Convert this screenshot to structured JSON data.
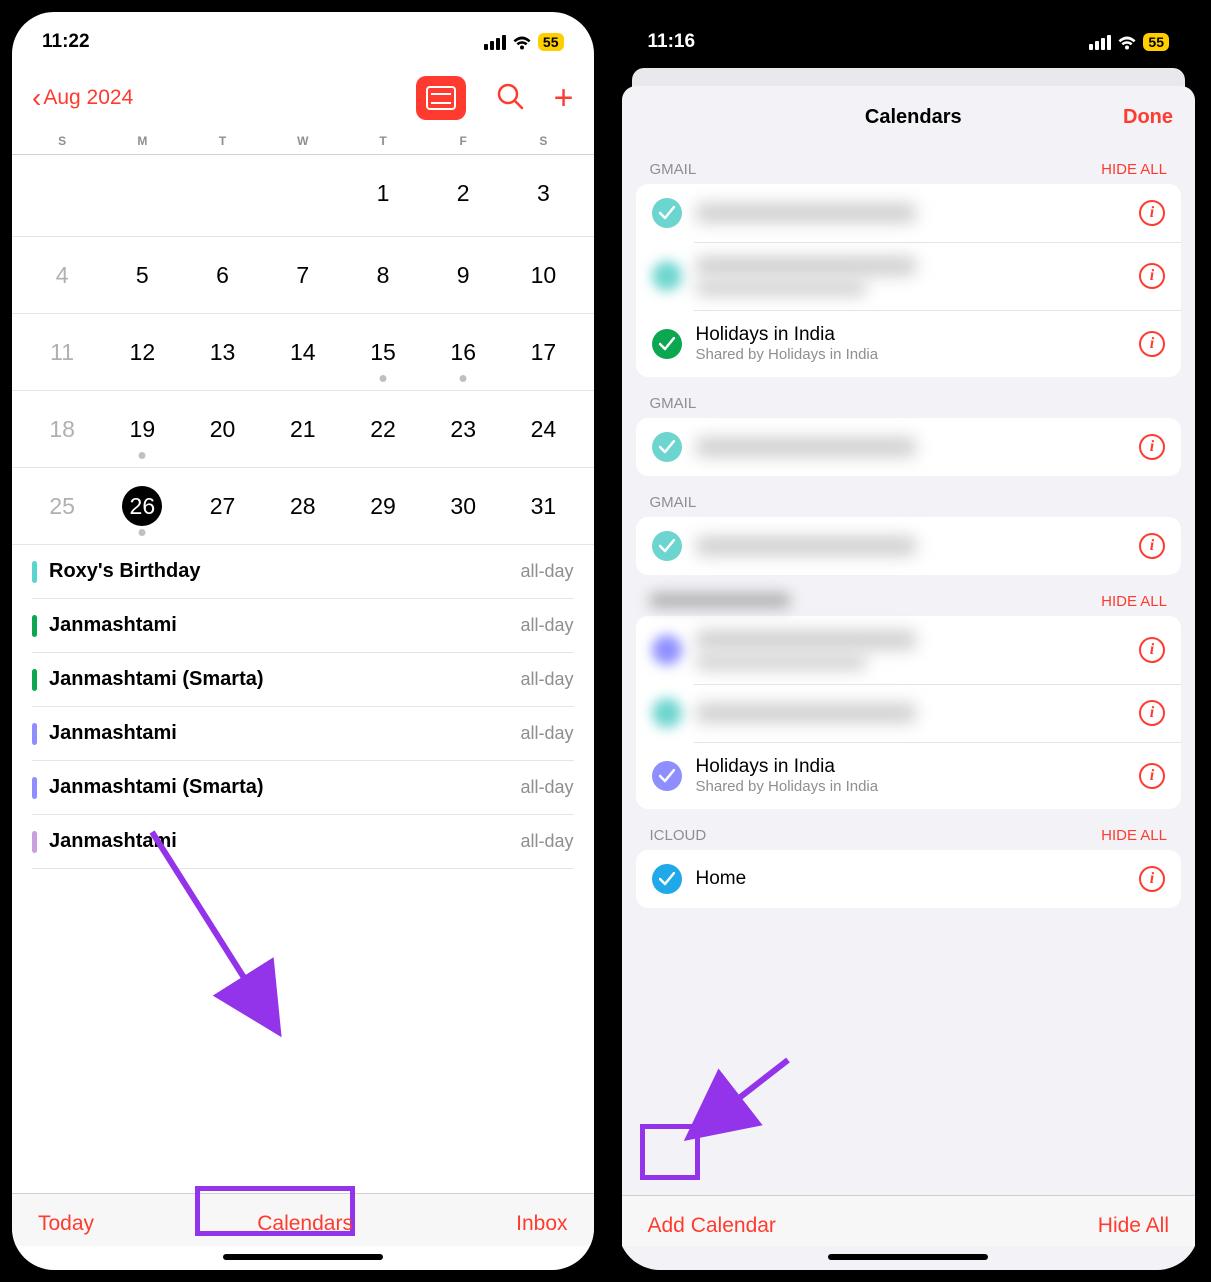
{
  "left": {
    "status": {
      "time": "11:22",
      "battery": "55"
    },
    "header": {
      "back": "Aug 2024"
    },
    "weekdays": [
      "S",
      "M",
      "T",
      "W",
      "T",
      "F",
      "S"
    ],
    "weeks": [
      [
        {
          "n": "",
          "d": false
        },
        {
          "n": "",
          "d": false
        },
        {
          "n": "",
          "d": false
        },
        {
          "n": "",
          "d": false
        },
        {
          "n": "1",
          "d": false
        },
        {
          "n": "2",
          "d": false
        },
        {
          "n": "3",
          "d": false
        }
      ],
      [
        {
          "n": "4",
          "d": true
        },
        {
          "n": "5",
          "d": false
        },
        {
          "n": "6",
          "d": false
        },
        {
          "n": "7",
          "d": false
        },
        {
          "n": "8",
          "d": false
        },
        {
          "n": "9",
          "d": false
        },
        {
          "n": "10",
          "d": false
        }
      ],
      [
        {
          "n": "11",
          "d": true
        },
        {
          "n": "12",
          "d": false
        },
        {
          "n": "13",
          "d": false
        },
        {
          "n": "14",
          "d": false
        },
        {
          "n": "15",
          "d": false,
          "dot": true
        },
        {
          "n": "16",
          "d": false,
          "dot": true
        },
        {
          "n": "17",
          "d": false
        }
      ],
      [
        {
          "n": "18",
          "d": true
        },
        {
          "n": "19",
          "d": false,
          "dot": true
        },
        {
          "n": "20",
          "d": false
        },
        {
          "n": "21",
          "d": false
        },
        {
          "n": "22",
          "d": false
        },
        {
          "n": "23",
          "d": false
        },
        {
          "n": "24",
          "d": false
        }
      ],
      [
        {
          "n": "25",
          "d": true
        },
        {
          "n": "26",
          "d": false,
          "today": true,
          "dot": true
        },
        {
          "n": "27",
          "d": false
        },
        {
          "n": "28",
          "d": false
        },
        {
          "n": "29",
          "d": false
        },
        {
          "n": "30",
          "d": false
        },
        {
          "n": "31",
          "d": false
        }
      ]
    ],
    "events": [
      {
        "title": "Roxy's Birthday",
        "time": "all-day",
        "color": "#5ad4cf"
      },
      {
        "title": "Janmashtami",
        "time": "all-day",
        "color": "#0ca750"
      },
      {
        "title": "Janmashtami (Smarta)",
        "time": "all-day",
        "color": "#0ca750"
      },
      {
        "title": "Janmashtami",
        "time": "all-day",
        "color": "#8e8eff"
      },
      {
        "title": "Janmashtami (Smarta)",
        "time": "all-day",
        "color": "#8e8eff"
      },
      {
        "title": "Janmashtami",
        "time": "all-day",
        "color": "#c99fdf"
      }
    ],
    "toolbar": {
      "today": "Today",
      "calendars": "Calendars",
      "inbox": "Inbox"
    }
  },
  "right": {
    "status": {
      "time": "11:16",
      "battery": "55"
    },
    "sheet": {
      "title": "Calendars",
      "done": "Done"
    },
    "sections": [
      {
        "header": "GMAIL",
        "hideAll": "HIDE ALL",
        "items": [
          {
            "check": "#6dd5cf",
            "blurred": true
          },
          {
            "check": "#6dd5cf",
            "checkBlur": true,
            "blurred": true,
            "sub": true
          },
          {
            "check": "#0ca750",
            "name": "Holidays in India",
            "subText": "Shared by Holidays in India"
          }
        ]
      },
      {
        "header": "GMAIL",
        "items": [
          {
            "check": "#6dd5cf",
            "blurred": true
          }
        ]
      },
      {
        "header": "GMAIL",
        "items": [
          {
            "check": "#6dd5cf",
            "blurred": true
          }
        ]
      },
      {
        "headerBlurred": true,
        "hideAll": "HIDE ALL",
        "items": [
          {
            "check": "#8e8eff",
            "checkBlur": true,
            "blurred": true,
            "sub": true
          },
          {
            "check": "#6dd5cf",
            "checkBlur": true,
            "blurred": true
          },
          {
            "check": "#8e8eff",
            "name": "Holidays in India",
            "subText": "Shared by Holidays in India"
          }
        ]
      },
      {
        "header": "ICLOUD",
        "hideAll": "HIDE ALL",
        "items": [
          {
            "check": "#1fa9e8",
            "name": "Home",
            "highlight": true
          }
        ]
      }
    ],
    "footer": {
      "add": "Add Calendar",
      "hide": "Hide All"
    }
  }
}
